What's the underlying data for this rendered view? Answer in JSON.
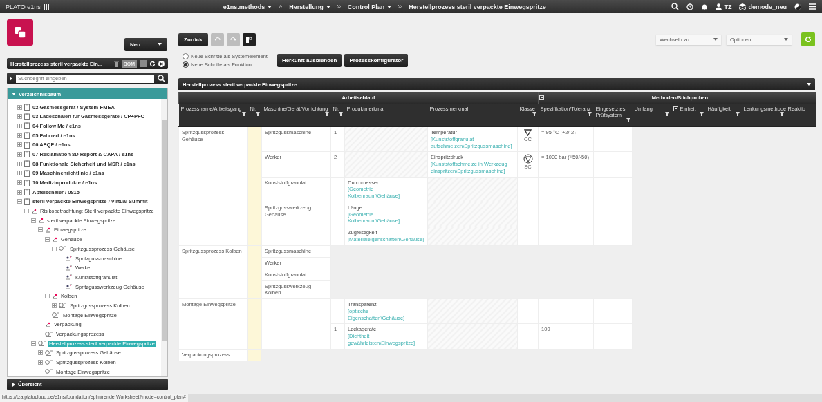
{
  "topbar": {
    "brand": "PLATO e1ns",
    "breadcrumbs": [
      {
        "label": "e1ns.methods",
        "dropdown": true
      },
      {
        "label": "Herstellung",
        "dropdown": true
      },
      {
        "label": "Control Plan",
        "dropdown": true
      },
      {
        "label": "Herstellprozess steril verpackte Einwegspritze",
        "dropdown": false
      }
    ],
    "user": "TZ",
    "workspace": "demode_neu"
  },
  "sidebar": {
    "new_button": "Neu",
    "title": "Herstellprozess steril verpackte Ein...",
    "bom": "BOM",
    "search": {
      "placeholder": "Suchbegriff eingeben"
    },
    "tree_title": "Verzeichnisbaum",
    "tree": [
      {
        "label": "02 Gasmessgerät / System-FMEA",
        "kind": "project",
        "expanded": false,
        "selected": false
      },
      {
        "label": "03 Ladeschalen für Gasmessgeräte / CP+PFC",
        "kind": "project",
        "expanded": false,
        "selected": false
      },
      {
        "label": "04 Follow Me / e1ns",
        "kind": "project",
        "expanded": false,
        "selected": false
      },
      {
        "label": "05 Fahrrad / e1ns",
        "kind": "project",
        "expanded": false,
        "selected": false
      },
      {
        "label": "06 APQP / e1ns",
        "kind": "project",
        "expanded": false,
        "selected": false
      },
      {
        "label": "07 Reklamation 8D Report & CAPA / e1ns",
        "kind": "project",
        "expanded": false,
        "selected": false
      },
      {
        "label": "08 Funktionale Sicherheit und MSR / e1ns",
        "kind": "project",
        "expanded": false,
        "selected": false
      },
      {
        "label": "09 Maschinenrichtlinie / e1ns",
        "kind": "project",
        "expanded": false,
        "selected": false
      },
      {
        "label": "10 Medizinprodukte / e1ns",
        "kind": "project",
        "expanded": false,
        "selected": false
      },
      {
        "label": "Apfelschäler / 0815",
        "kind": "project",
        "expanded": false,
        "selected": false
      },
      {
        "label": "steril verpackte Einwegspritze / Virtual Summit",
        "kind": "project",
        "expanded": true,
        "selected": false,
        "children": [
          {
            "label": "Risikobetrachtung: Steril verpackte Einwegspritze",
            "kind": "function",
            "expanded": true,
            "selected": false,
            "children": [
              {
                "label": "steril verpackte Einwegspritze",
                "kind": "function",
                "expanded": true,
                "selected": false,
                "children": [
                  {
                    "label": "Einwegspritze",
                    "kind": "function",
                    "expanded": true,
                    "selected": false,
                    "children": [
                      {
                        "label": "Gehäuse",
                        "kind": "function",
                        "expanded": true,
                        "selected": false,
                        "children": [
                          {
                            "label": "Spritzgussprozess Gehäuse",
                            "kind": "process",
                            "expanded": true,
                            "selected": false,
                            "children": [
                              {
                                "label": "Spritzgussmaschine",
                                "kind": "resource",
                                "selected": false
                              },
                              {
                                "label": "Werker",
                                "kind": "resource",
                                "selected": false
                              },
                              {
                                "label": "Kunststoffgranulat",
                                "kind": "resource",
                                "selected": false
                              },
                              {
                                "label": "Spritzgusswerkzeug Gehäuse",
                                "kind": "resource",
                                "selected": false
                              }
                            ]
                          }
                        ]
                      },
                      {
                        "label": "Kolben",
                        "kind": "function",
                        "expanded": true,
                        "selected": false,
                        "children": [
                          {
                            "label": "Spritzgussprozess Kolben",
                            "kind": "process",
                            "expanded": false,
                            "selected": false
                          }
                        ]
                      },
                      {
                        "label": "Montage Einwegspritze",
                        "kind": "process",
                        "selected": false
                      }
                    ]
                  },
                  {
                    "label": "Verpackung",
                    "kind": "function",
                    "selected": false
                  },
                  {
                    "label": "Verpackungsprozess",
                    "kind": "process",
                    "selected": false
                  }
                ]
              },
              {
                "label": "Herstellprozess steril verpackte Einwegspritze",
                "kind": "process",
                "expanded": true,
                "selected": true,
                "children": [
                  {
                    "label": "Spritzgussprozess Gehäuse",
                    "kind": "process",
                    "expanded": false,
                    "selected": false
                  },
                  {
                    "label": "Spritzgussprozess Kolben",
                    "kind": "process",
                    "expanded": false,
                    "selected": false
                  },
                  {
                    "label": "Montage Einwegspritze",
                    "kind": "process",
                    "selected": false
                  }
                ]
              }
            ]
          }
        ]
      }
    ],
    "overview": "Übersicht"
  },
  "toolbar": {
    "back": "Zurück",
    "switch_to": "Wechseln zu...",
    "options": "Optionen",
    "radios": [
      {
        "label": "Neue Schritte als Systemelement",
        "selected": false
      },
      {
        "label": "Neue Schritte als Funktion",
        "selected": true
      }
    ],
    "buttons": [
      "Herkunft ausblenden",
      "Prozesskonfigurator"
    ]
  },
  "worksheet": {
    "title": "Herstellprozess steril verpackte Einwegspritze",
    "groups": [
      {
        "label": "Arbeitsablauf",
        "collapsible": false,
        "columns": [
          {
            "label": "Prozessname/Arbeitsgang",
            "filter": true
          },
          {
            "label": "Nr.",
            "filter": true
          },
          {
            "label": "Maschine/Gerät/Vorrichtung",
            "filter": true
          },
          {
            "label": "Nr.",
            "filter": true
          },
          {
            "label": "Produktmerkmal",
            "filter": false
          },
          {
            "label": "Prozessmerkmal",
            "filter": false
          },
          {
            "label": "Klasse",
            "filter": true
          }
        ]
      },
      {
        "label": "Methoden/Stichproben",
        "collapsible": true,
        "columns": [
          {
            "label": "Spezifikation/Toleranz",
            "filter": true
          },
          {
            "label": "Eingesetztes Prüfsystem",
            "filter": true
          },
          {
            "label": "Umfang",
            "filter": true
          },
          {
            "label": "Einheit",
            "filter": true,
            "collapsible": true
          },
          {
            "label": "Häufigkeit",
            "filter": true
          },
          {
            "label": "Lenkungsmethode",
            "filter": true
          },
          {
            "label": "Reaktio",
            "filter": false
          }
        ]
      }
    ],
    "processes": [
      {
        "name": "Spritzgussprozess Gehäuse",
        "machines": [
          {
            "name": "Spritzgussmaschine",
            "features": [
              {
                "nr": "1",
                "process": "Temperatur",
                "process_ref": "[Kunststoffgranulat aufschmelzen\\Spritzgussmaschine]",
                "class": {
                  "kind": "cc",
                  "label": "CC"
                },
                "spec": "= 95 °C (+2/-2)"
              }
            ]
          },
          {
            "name": "Werker",
            "features": [
              {
                "nr": "2",
                "process": "Einspritzdruck",
                "process_ref": "[Kunststoffschmelze in Werkzeug einspritzen\\Spritzgussmaschine]",
                "class": {
                  "kind": "sc",
                  "label": "SC"
                },
                "spec": "= 1000 bar (+50/-50)"
              }
            ]
          },
          {
            "name": "Kunststoffgranulat",
            "features": [
              {
                "product": "Durchmesser",
                "product_ref": "[Geometrie Kolbenraum\\Gehäuse]"
              }
            ]
          },
          {
            "name": "Spritzgusswerkzeug Gehäuse",
            "features": [
              {
                "product": "Länge",
                "product_ref": "[Geometrie Kolbenraum\\Gehäuse]"
              },
              {
                "product": "Zugfestigkeit",
                "product_ref": "[Materialeigenschaften\\Gehäuse]"
              }
            ]
          }
        ]
      },
      {
        "name": "Spritzgussprozess Kolben",
        "machines": [
          {
            "name": "Spritzgussmaschine"
          },
          {
            "name": "Werker"
          },
          {
            "name": "Kunststoffgranulat"
          },
          {
            "name": "Spritzgusswerkzeug Kolben"
          }
        ]
      },
      {
        "name": "Montage Einwegspritze",
        "machines": [
          {
            "features": [
              {
                "product": "Transparenz",
                "product_ref": "[optische Eigenschaften\\Gehäuse]"
              },
              {
                "nr": "1",
                "product": "Leckagerate",
                "product_ref": "[Dichtheit gewährleisten\\Einwegspritze]",
                "spec": "100"
              }
            ]
          }
        ]
      },
      {
        "name": "Verpackungsprozess"
      }
    ]
  },
  "status_url": "https://tza.platocloud.de/e1ns/foundation/eplm/renderWorksheet?mode=control_plan#"
}
